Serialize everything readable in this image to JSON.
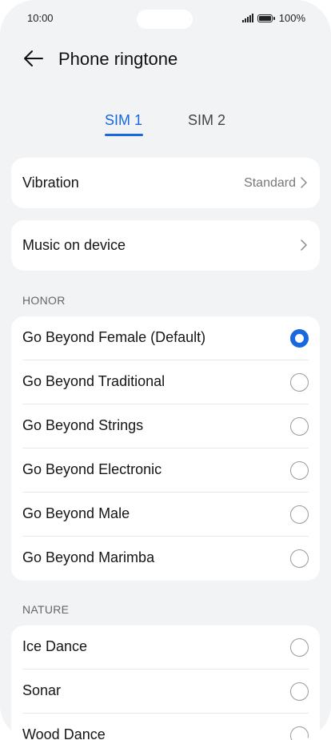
{
  "status": {
    "time": "10:00",
    "battery": "100%"
  },
  "header": {
    "title": "Phone ringtone"
  },
  "tabs": [
    {
      "label": "SIM 1",
      "selected": true
    },
    {
      "label": "SIM 2",
      "selected": false
    }
  ],
  "vibration": {
    "label": "Vibration",
    "value": "Standard"
  },
  "music": {
    "label": "Music on device"
  },
  "honor": {
    "header": "HONOR",
    "items": [
      {
        "label": "Go Beyond Female (Default)",
        "selected": true
      },
      {
        "label": "Go Beyond Traditional",
        "selected": false
      },
      {
        "label": "Go Beyond Strings",
        "selected": false
      },
      {
        "label": "Go Beyond Electronic",
        "selected": false
      },
      {
        "label": "Go Beyond Male",
        "selected": false
      },
      {
        "label": "Go Beyond Marimba",
        "selected": false
      }
    ]
  },
  "nature": {
    "header": "NATURE",
    "items": [
      {
        "label": "Ice Dance",
        "selected": false
      },
      {
        "label": "Sonar",
        "selected": false
      },
      {
        "label": "Wood Dance",
        "selected": false
      }
    ]
  },
  "colors": {
    "accent": "#1769e0",
    "background": "#f1f3f5"
  }
}
